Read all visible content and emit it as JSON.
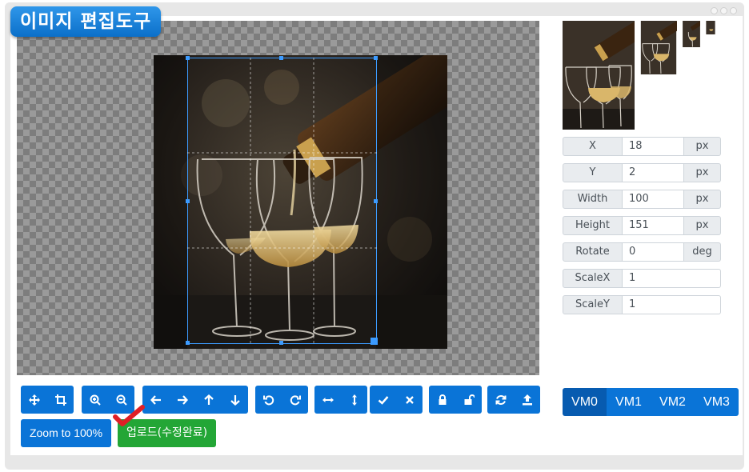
{
  "app": {
    "title": "이미지 편집도구"
  },
  "data_fields": [
    {
      "label": "X",
      "value": "18",
      "unit": "px"
    },
    {
      "label": "Y",
      "value": "2",
      "unit": "px"
    },
    {
      "label": "Width",
      "value": "100",
      "unit": "px"
    },
    {
      "label": "Height",
      "value": "151",
      "unit": "px"
    },
    {
      "label": "Rotate",
      "value": "0",
      "unit": "deg"
    },
    {
      "label": "ScaleX",
      "value": "1",
      "unit": ""
    },
    {
      "label": "ScaleY",
      "value": "1",
      "unit": ""
    }
  ],
  "toolbar": {
    "groups": [
      [
        "move-icon",
        "crop-icon"
      ],
      [
        "zoom-in-icon",
        "zoom-out-icon"
      ],
      [
        "arrow-left-icon",
        "arrow-right-icon",
        "arrow-up-icon",
        "arrow-down-icon"
      ],
      [
        "rotate-left-icon",
        "rotate-right-icon"
      ],
      [
        "flip-horizontal-icon",
        "flip-vertical-icon"
      ],
      [
        "check-icon",
        "close-icon"
      ],
      [
        "lock-icon",
        "unlock-icon"
      ],
      [
        "refresh-icon",
        "upload-icon"
      ]
    ],
    "zoom_label": "Zoom to 100%",
    "upload_label": "업로드(수정완료)"
  },
  "view_modes": {
    "items": [
      "VM0",
      "VM1",
      "VM2",
      "VM3"
    ],
    "selected": "VM0"
  },
  "colors": {
    "primary": "#0a74d7",
    "success": "#23a636",
    "crop_border": "#3c9bff",
    "title_bg": "#1e88e5"
  }
}
